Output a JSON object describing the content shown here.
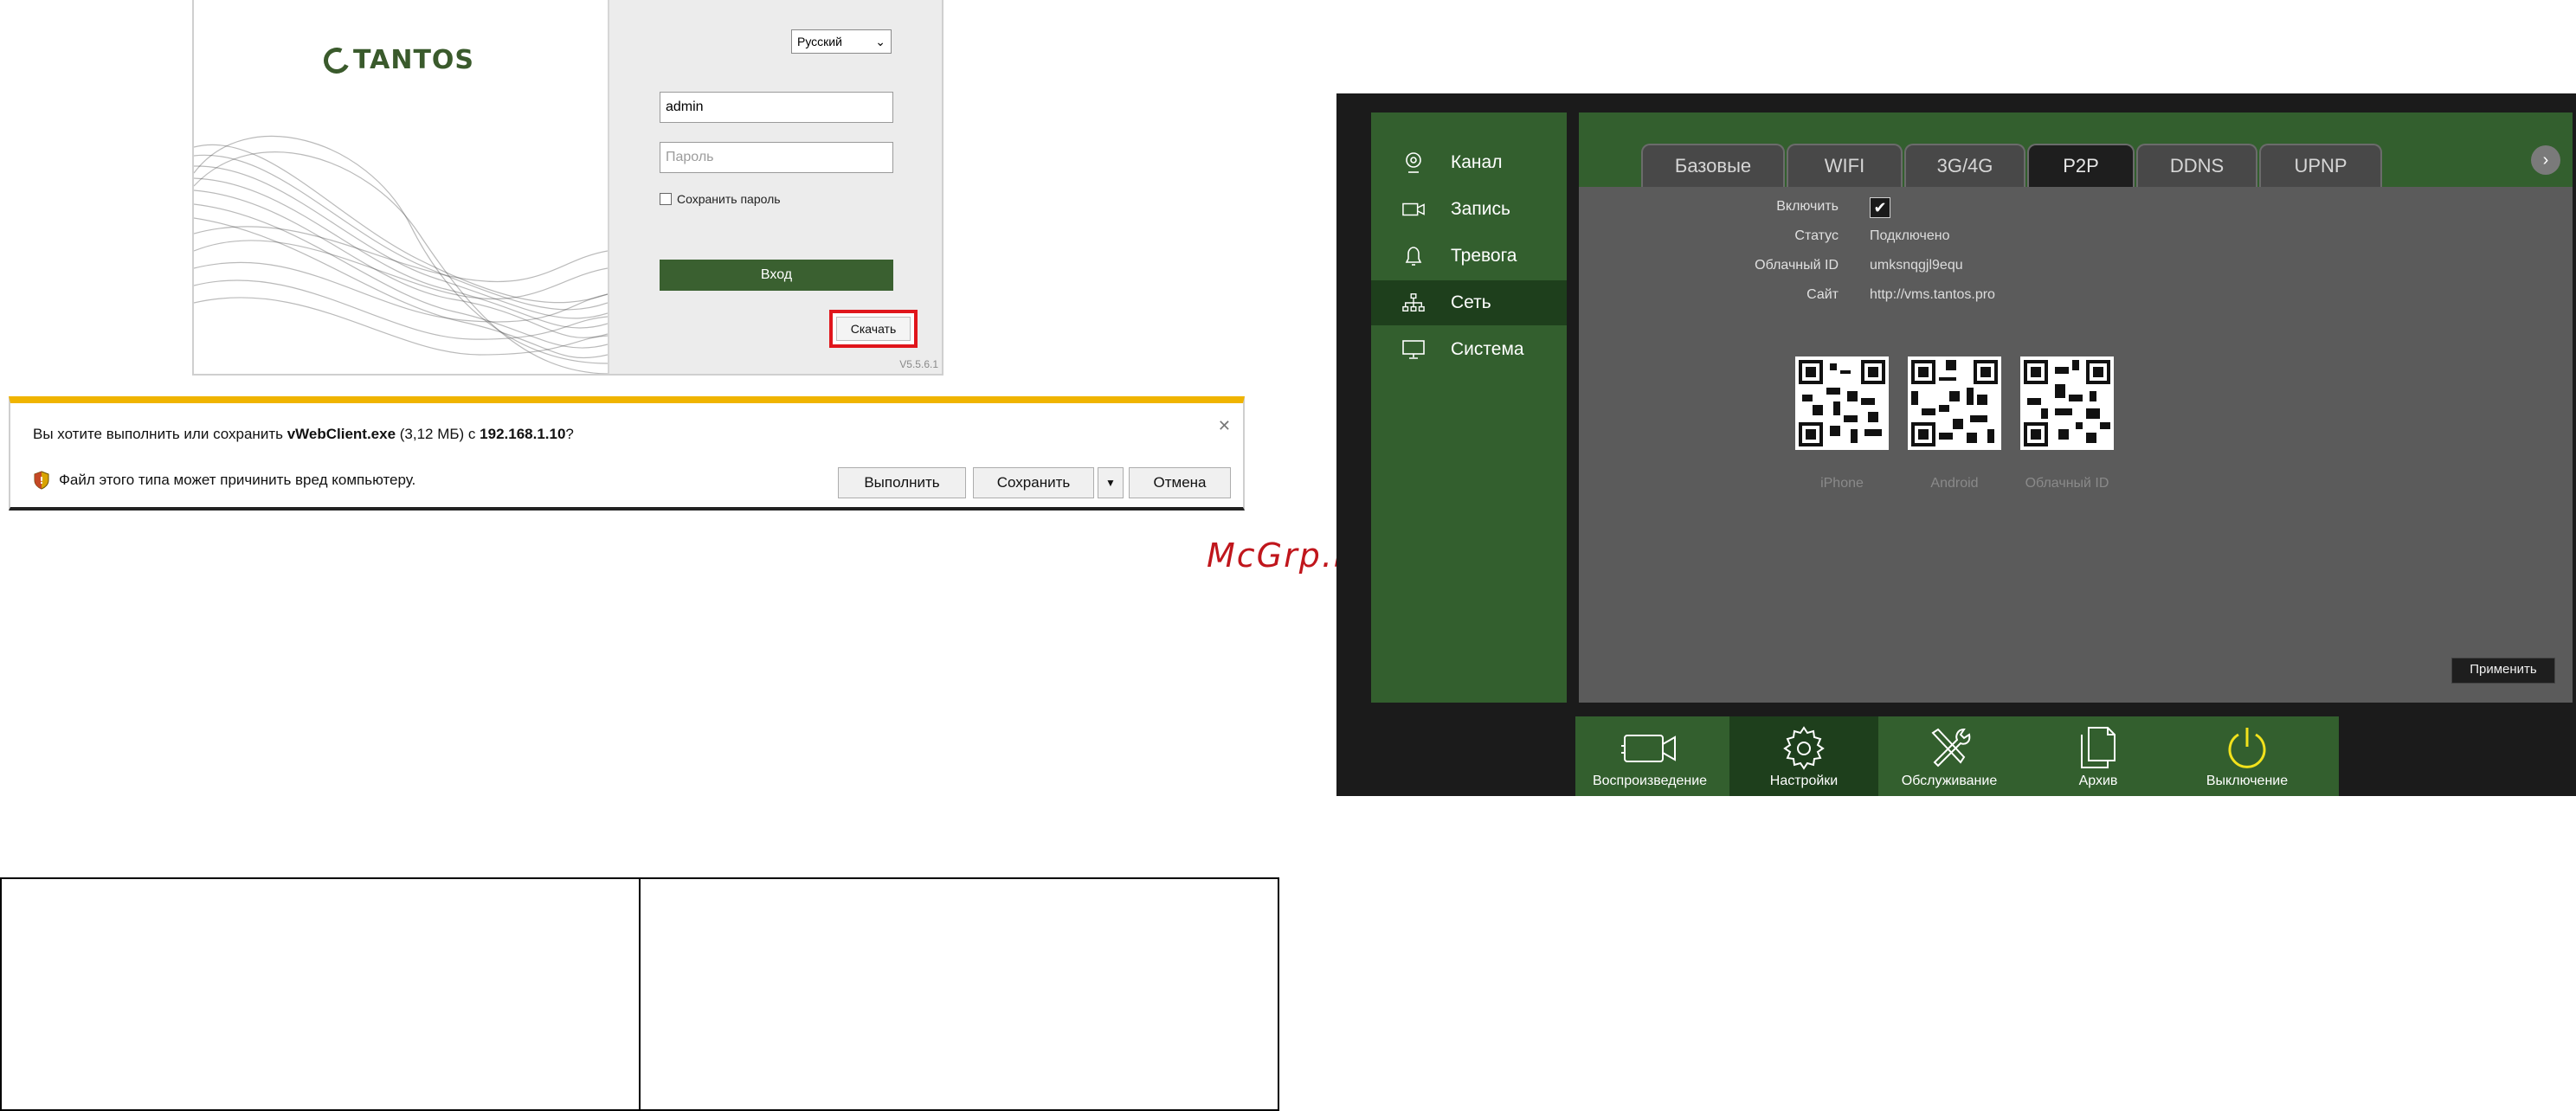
{
  "login": {
    "logo_text": "TANTOS",
    "language": "Русский",
    "username": "admin",
    "password_placeholder": "Пароль",
    "remember_label": "Сохранить пароль",
    "login_button": "Вход",
    "download_button": "Скачать",
    "version": "V5.5.6.1"
  },
  "download_bar": {
    "question_prefix": "Вы хотите выполнить или сохранить ",
    "file_name": "vWebClient.exe",
    "file_size": " (3,12 МБ) с ",
    "host": "192.168.1.10",
    "question_suffix": "?",
    "warning": "Файл этого типа может причинить вред компьютеру.",
    "run_button": "Выполнить",
    "save_button": "Сохранить",
    "cancel_button": "Отмена"
  },
  "dvr": {
    "sidebar": [
      {
        "label": "Канал",
        "icon": "camera-icon"
      },
      {
        "label": "Запись",
        "icon": "record-icon"
      },
      {
        "label": "Тревога",
        "icon": "bell-icon"
      },
      {
        "label": "Сеть",
        "icon": "network-icon",
        "active": true
      },
      {
        "label": "Система",
        "icon": "monitor-icon"
      }
    ],
    "tabs": [
      "Базовые",
      "WIFI",
      "3G/4G",
      "P2P",
      "DDNS",
      "UPNP"
    ],
    "active_tab": "P2P",
    "fields": {
      "enable_label": "Включить",
      "enable_checked": true,
      "status_label": "Статус",
      "status_value": "Подключено",
      "cloud_id_label": "Облачный ID",
      "cloud_id_value": "umksnqgjl9equ",
      "site_label": "Сайт",
      "site_value": "http://vms.tantos.pro"
    },
    "qr_labels": [
      "iPhone",
      "Android",
      "Облачный ID"
    ],
    "apply_button": "Применить",
    "bottom_bar": [
      {
        "label": "Воспроизведение",
        "icon": "playback-icon"
      },
      {
        "label": "Настройки",
        "icon": "settings-gear-icon",
        "active": true
      },
      {
        "label": "Обслуживание",
        "icon": "maintenance-tools-icon"
      },
      {
        "label": "Архив",
        "icon": "archive-icon"
      },
      {
        "label": "Выключение",
        "icon": "power-icon"
      }
    ]
  },
  "watermark": "McGrp.Ru"
}
